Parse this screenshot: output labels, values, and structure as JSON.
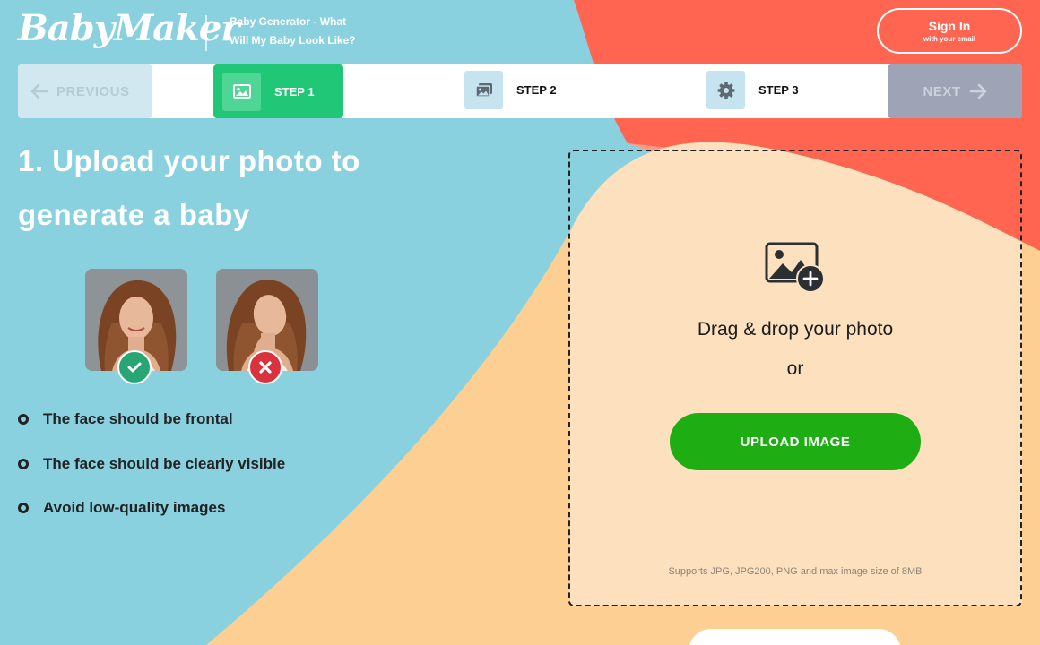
{
  "header": {
    "logo": "BabyMaker",
    "tagline_line1": "Baby Generator - What",
    "tagline_line2": "Will My Baby Look Like?",
    "signin_label": "Sign In",
    "signin_sub": "with your email"
  },
  "steps": {
    "previous_label": "PREVIOUS",
    "next_label": "NEXT",
    "items": [
      {
        "label": "STEP 1",
        "icon": "image-icon",
        "active": true
      },
      {
        "label": "STEP 2",
        "icon": "images-icon",
        "active": false
      },
      {
        "label": "STEP 3",
        "icon": "gear-icon",
        "active": false
      }
    ]
  },
  "main": {
    "heading_line1": "1. Upload your photo to",
    "heading_line2": "generate a baby",
    "examples": [
      {
        "icon": "check-icon",
        "status": "good"
      },
      {
        "icon": "close-icon",
        "status": "bad"
      }
    ],
    "rules": [
      "The face should be frontal",
      "The face should be clearly visible",
      "Avoid low-quality images"
    ]
  },
  "upload": {
    "icon": "add-image-icon",
    "drag_text": "Drag & drop your photo",
    "or_text": "or",
    "button_label": "UPLOAD IMAGE",
    "supports_text": "Supports JPG, JPG200, PNG and max image size of 8MB"
  },
  "colors": {
    "sky": "#8ad1e0",
    "coral": "#ff6550",
    "peach": "#fdd9b0",
    "step_active": "#1fc776",
    "upload_button": "#1eae14",
    "good_badge": "#27a673",
    "bad_badge": "#d9343e"
  }
}
